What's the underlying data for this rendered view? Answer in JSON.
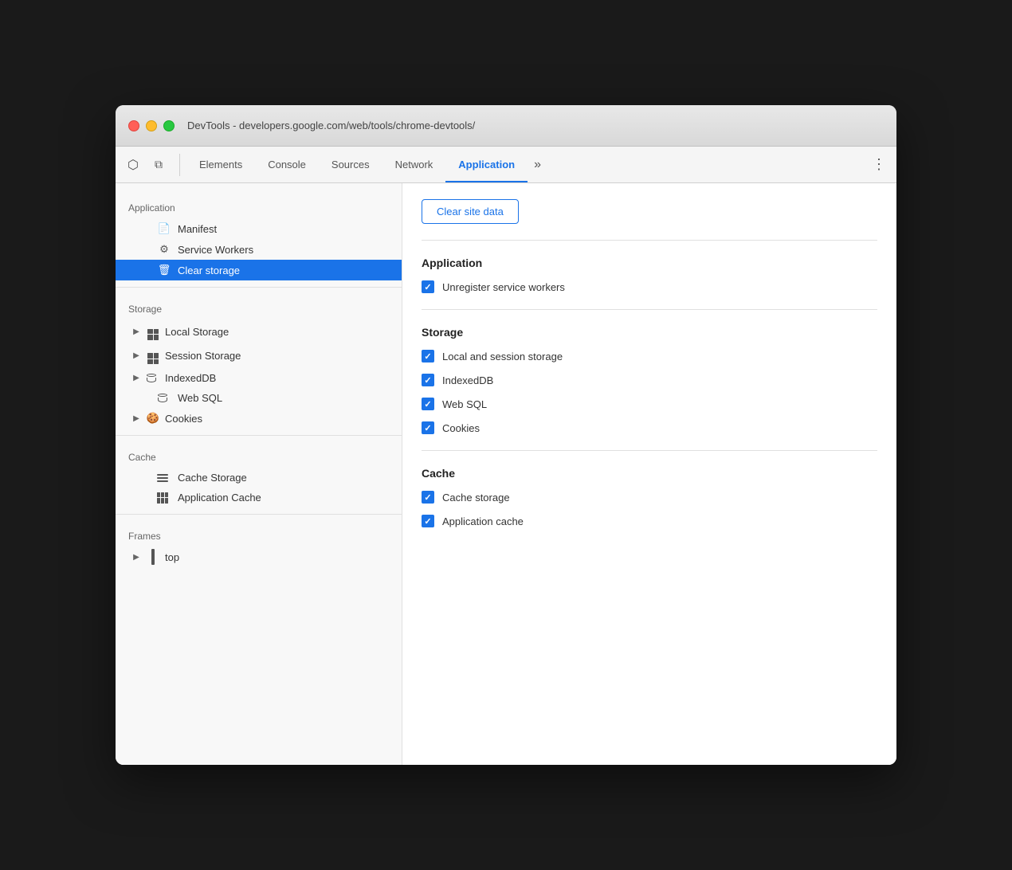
{
  "window": {
    "title": "DevTools - developers.google.com/web/tools/chrome-devtools/"
  },
  "tabs": [
    {
      "label": "Elements",
      "active": false
    },
    {
      "label": "Console",
      "active": false
    },
    {
      "label": "Sources",
      "active": false
    },
    {
      "label": "Network",
      "active": false
    },
    {
      "label": "Application",
      "active": true
    }
  ],
  "sidebar": {
    "application_section": "Application",
    "items_application": [
      {
        "label": "Manifest",
        "icon": "doc"
      },
      {
        "label": "Service Workers",
        "icon": "gear"
      },
      {
        "label": "Clear storage",
        "icon": "trash",
        "active": true
      }
    ],
    "storage_section": "Storage",
    "items_storage": [
      {
        "label": "Local Storage",
        "icon": "grid",
        "expandable": true
      },
      {
        "label": "Session Storage",
        "icon": "grid",
        "expandable": true
      },
      {
        "label": "IndexedDB",
        "icon": "cylinder",
        "expandable": true
      },
      {
        "label": "Web SQL",
        "icon": "cylinder"
      },
      {
        "label": "Cookies",
        "icon": "cookie",
        "expandable": true
      }
    ],
    "cache_section": "Cache",
    "items_cache": [
      {
        "label": "Cache Storage",
        "icon": "stacked"
      },
      {
        "label": "Application Cache",
        "icon": "app-cache"
      }
    ],
    "frames_section": "Frames",
    "items_frames": [
      {
        "label": "top",
        "icon": "frame",
        "expandable": true
      }
    ]
  },
  "panel": {
    "clear_button_label": "Clear site data",
    "application_section_title": "Application",
    "application_checkboxes": [
      {
        "label": "Unregister service workers",
        "checked": true
      }
    ],
    "storage_section_title": "Storage",
    "storage_checkboxes": [
      {
        "label": "Local and session storage",
        "checked": true
      },
      {
        "label": "IndexedDB",
        "checked": true
      },
      {
        "label": "Web SQL",
        "checked": true
      },
      {
        "label": "Cookies",
        "checked": true
      }
    ],
    "cache_section_title": "Cache",
    "cache_checkboxes": [
      {
        "label": "Cache storage",
        "checked": true
      },
      {
        "label": "Application cache",
        "checked": true
      }
    ]
  }
}
